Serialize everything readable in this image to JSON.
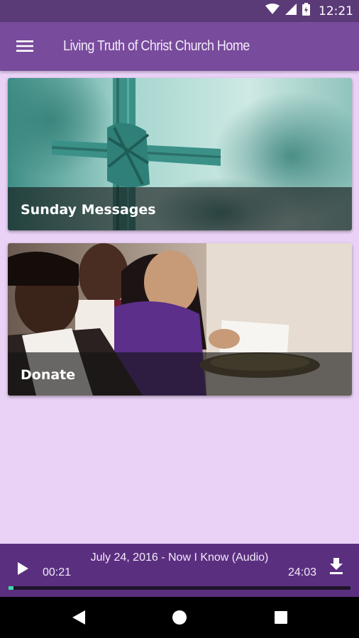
{
  "status_bar": {
    "time": "12:21",
    "icons": [
      "wifi-icon",
      "cell-signal-icon",
      "battery-icon"
    ]
  },
  "app_bar": {
    "title": "Living Truth of Christ Church Home",
    "menu_icon": "hamburger-menu-icon"
  },
  "cards": [
    {
      "label": "Sunday Messages"
    },
    {
      "label": "Donate"
    }
  ],
  "player": {
    "track_title": "July 24, 2016 - Now I Know (Audio)",
    "elapsed": "00:21",
    "duration": "24:03",
    "progress": 0.015,
    "play_icon": "play-icon",
    "download_icon": "download-icon"
  },
  "nav_bar": {
    "icons": [
      "back-icon",
      "home-icon",
      "recents-icon"
    ]
  },
  "colors": {
    "app_bar": "#784b9c",
    "status_bar": "#5b3a78",
    "background": "#ead2f7",
    "player": "#5b2f80",
    "progress_accent": "#40d9a8"
  }
}
